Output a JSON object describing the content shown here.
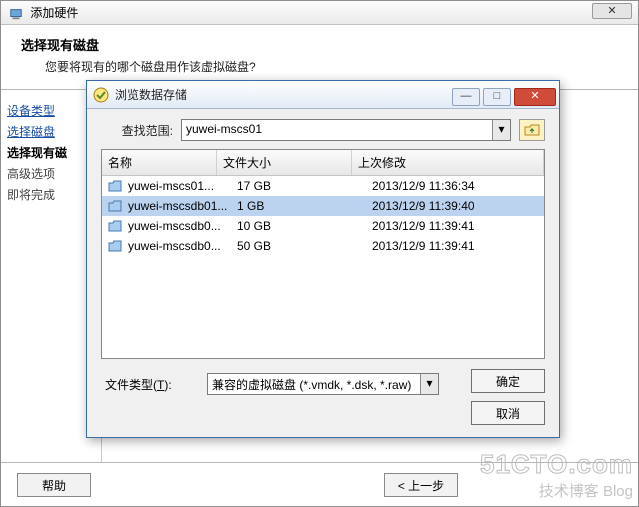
{
  "wizard": {
    "title": "添加硬件",
    "close_glyph": "✕",
    "head_title": "选择现有磁盘",
    "head_desc": "您要将现有的哪个磁盘用作该虚拟磁盘?",
    "side": {
      "device_type": "设备类型",
      "select_disk": "选择磁盘",
      "select_existing": "选择现有磁",
      "advanced": "高级选项",
      "ready": "即将完成"
    },
    "help_label": "帮助",
    "back_label": "< 上一步"
  },
  "dialog": {
    "title": "浏览数据存储",
    "scope_label": "查找范围:",
    "scope_value": "yuwei-mscs01",
    "columns": {
      "name": "名称",
      "size": "文件大小",
      "date": "上次修改"
    },
    "files": [
      {
        "name": "yuwei-mscs01...",
        "size": "17 GB",
        "date": "2013/12/9 11:36:34",
        "selected": false
      },
      {
        "name": "yuwei-mscsdb01...",
        "size": "1 GB",
        "date": "2013/12/9 11:39:40",
        "selected": true
      },
      {
        "name": "yuwei-mscsdb0...",
        "size": "10 GB",
        "date": "2013/12/9 11:39:41",
        "selected": false
      },
      {
        "name": "yuwei-mscsdb0...",
        "size": "50 GB",
        "date": "2013/12/9 11:39:41",
        "selected": false
      }
    ],
    "filter_label_pre": "文件类型(",
    "filter_label_u": "T",
    "filter_label_post": "):",
    "filter_value": "兼容的虚拟磁盘 (*.vmdk, *.dsk, *.raw)",
    "ok_label": "确定",
    "cancel_label": "取消"
  },
  "watermark": {
    "line1": "51CTO.com",
    "line2": "技术博客  Blog"
  }
}
